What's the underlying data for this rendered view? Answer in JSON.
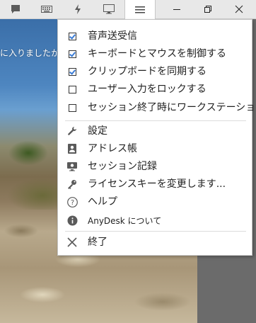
{
  "remote": {
    "partial_text": "に入りましたか?"
  },
  "toolbar": {
    "buttons": [
      {
        "name": "chat",
        "icon": "chat-icon"
      },
      {
        "name": "keyboard",
        "icon": "keyboard-icon"
      },
      {
        "name": "actions",
        "icon": "lightning-icon"
      },
      {
        "name": "display",
        "icon": "monitor-icon"
      },
      {
        "name": "menu",
        "icon": "hamburger-menu-icon",
        "active": true
      }
    ],
    "window_controls": [
      "minimize-icon",
      "restore-icon",
      "close-icon"
    ]
  },
  "menu": {
    "checkbox_items": [
      {
        "label": "音声送受信",
        "checked": true
      },
      {
        "label": "キーボードとマウスを制御する",
        "checked": true
      },
      {
        "label": "クリップボードを同期する",
        "checked": true
      },
      {
        "label": "ユーザー入力をロックする",
        "checked": false
      },
      {
        "label": "セッション終了時にワークステーショ...",
        "checked": false
      }
    ],
    "action_items": [
      {
        "label": "設定",
        "icon": "wrench-icon"
      },
      {
        "label": "アドレス帳",
        "icon": "address-book-icon"
      },
      {
        "label": "セッション記録",
        "icon": "session-recording-icon"
      },
      {
        "label": "ライセンスキーを変更します...",
        "icon": "license-key-icon"
      },
      {
        "label": "ヘルプ",
        "icon": "help-icon"
      },
      {
        "label": "AnyDesk について",
        "icon": "info-icon"
      }
    ],
    "exit_item": {
      "label": "終了",
      "icon": "close-x-icon"
    }
  },
  "colors": {
    "accent_check": "#3a7bd5",
    "menu_bg": "#ffffff",
    "toolbar_bg": "#e8e8e8",
    "icon_gray": "#5a5a5a"
  }
}
